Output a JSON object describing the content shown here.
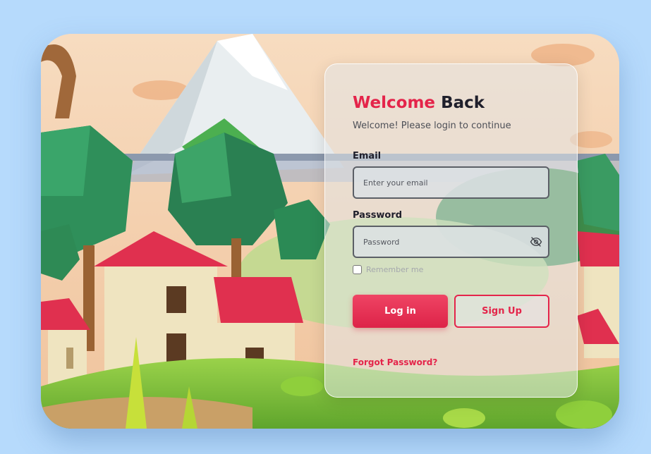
{
  "login": {
    "title_accent": "Welcome",
    "title_rest": "Back",
    "subtitle": "Welcome! Please login to continue",
    "email_label": "Email",
    "email_placeholder": "Enter your email",
    "password_label": "Password",
    "password_placeholder": "Password",
    "remember_label": "Remember me",
    "login_button": "Log in",
    "signup_button": "Sign Up",
    "forgot_link": "Forgot Password?"
  },
  "icons": {
    "password_toggle": "eye-slash-icon"
  },
  "colors": {
    "page_background": "#b6dafc",
    "accent": "#e4244a",
    "text_dark": "#1f1f2b",
    "text_muted": "#4d4f57"
  }
}
